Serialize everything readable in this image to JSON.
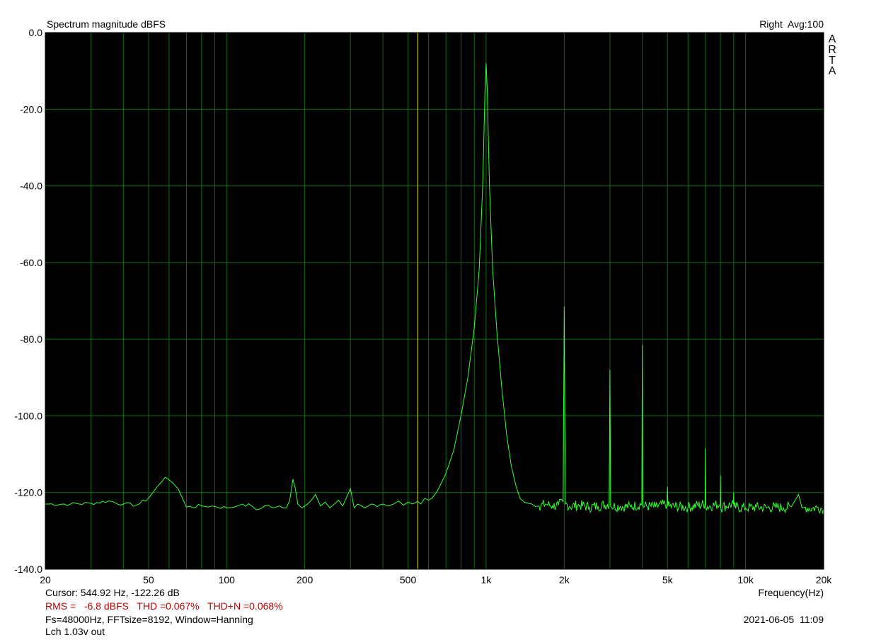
{
  "header": {
    "title": "Spectrum magnitude dBFS",
    "channel_avg": "Right  Avg:100",
    "brand_letters": [
      "A",
      "R",
      "T",
      "A"
    ]
  },
  "footer": {
    "cursor": "Cursor: 544.92 Hz, -122.26 dB",
    "metrics": "RMS =   -6.8 dBFS   THD =0.067%   THD+N =0.068%",
    "settings": "Fs=48000Hz, FFTsize=8192, Window=Hanning",
    "label": "Lch 1.03v out",
    "datetime": "2021-06-05  11:09"
  },
  "colors": {
    "plot_bg": "#000000",
    "grid": "#0d6e0d",
    "trace": "#33ff33",
    "cursor": "#e0e000",
    "metrics_text": "#c00000"
  },
  "chart_data": {
    "type": "line",
    "x_scale": "log",
    "xlim": [
      20,
      20000
    ],
    "ylim": [
      -140,
      0
    ],
    "xlabel": "Frequency(Hz)",
    "ylabel": "",
    "x_ticks": [
      {
        "value": 20,
        "label": "20"
      },
      {
        "value": 50,
        "label": "50"
      },
      {
        "value": 100,
        "label": "100"
      },
      {
        "value": 200,
        "label": "200"
      },
      {
        "value": 500,
        "label": "500"
      },
      {
        "value": 1000,
        "label": "1k"
      },
      {
        "value": 2000,
        "label": "2k"
      },
      {
        "value": 5000,
        "label": "5k"
      },
      {
        "value": 10000,
        "label": "10k"
      },
      {
        "value": 20000,
        "label": "20k"
      }
    ],
    "y_ticks": [
      {
        "value": 0,
        "label": "0.0"
      },
      {
        "value": -20,
        "label": "-20.0"
      },
      {
        "value": -40,
        "label": "-40.0"
      },
      {
        "value": -60,
        "label": "-60.0"
      },
      {
        "value": -80,
        "label": "-80.0"
      },
      {
        "value": -100,
        "label": "-100.0"
      },
      {
        "value": -120,
        "label": "-120.0"
      },
      {
        "value": -140,
        "label": "-140.0"
      }
    ],
    "cursor_x": 544.92,
    "grid": true,
    "series": [
      {
        "points": [
          [
            20,
            -123
          ],
          [
            25,
            -123
          ],
          [
            30,
            -122.8
          ],
          [
            35,
            -122.2
          ],
          [
            40,
            -123
          ],
          [
            45,
            -123.3
          ],
          [
            50,
            -121.5
          ],
          [
            54,
            -118.5
          ],
          [
            58,
            -116
          ],
          [
            62,
            -117.5
          ],
          [
            65,
            -119
          ],
          [
            70,
            -123.8
          ],
          [
            80,
            -123.5
          ],
          [
            90,
            -123.6
          ],
          [
            100,
            -124
          ],
          [
            110,
            -123.5
          ],
          [
            115,
            -123
          ],
          [
            125,
            -123.5
          ],
          [
            130,
            -124.5
          ],
          [
            140,
            -123.5
          ],
          [
            150,
            -124
          ],
          [
            160,
            -123.5
          ],
          [
            170,
            -124
          ],
          [
            175,
            -122
          ],
          [
            180,
            -116.5
          ],
          [
            184,
            -119
          ],
          [
            188,
            -123
          ],
          [
            195,
            -124
          ],
          [
            205,
            -123
          ],
          [
            212,
            -122
          ],
          [
            220,
            -120.5
          ],
          [
            230,
            -123.5
          ],
          [
            240,
            -122.5
          ],
          [
            250,
            -124
          ],
          [
            260,
            -123
          ],
          [
            270,
            -122
          ],
          [
            280,
            -123.5
          ],
          [
            300,
            -119
          ],
          [
            310,
            -124
          ],
          [
            320,
            -123
          ],
          [
            340,
            -124
          ],
          [
            360,
            -123
          ],
          [
            380,
            -123.7
          ],
          [
            400,
            -123
          ],
          [
            420,
            -123.5
          ],
          [
            440,
            -123
          ],
          [
            460,
            -122.2
          ],
          [
            480,
            -123.3
          ],
          [
            500,
            -122.5
          ],
          [
            520,
            -123
          ],
          [
            545,
            -122.3
          ],
          [
            560,
            -123
          ],
          [
            580,
            -121.5
          ],
          [
            600,
            -122
          ],
          [
            650,
            -119.5
          ],
          [
            700,
            -115
          ],
          [
            750,
            -109
          ],
          [
            800,
            -100
          ],
          [
            850,
            -90
          ],
          [
            900,
            -77
          ],
          [
            940,
            -62
          ],
          [
            970,
            -40
          ],
          [
            990,
            -15
          ],
          [
            1000,
            -8
          ],
          [
            1010,
            -15
          ],
          [
            1030,
            -40
          ],
          [
            1060,
            -62
          ],
          [
            1100,
            -78
          ],
          [
            1150,
            -93
          ],
          [
            1200,
            -105
          ],
          [
            1250,
            -113
          ],
          [
            1300,
            -118
          ],
          [
            1350,
            -121.5
          ],
          [
            1400,
            -122.5
          ],
          [
            1500,
            -123
          ],
          [
            1600,
            -123.5
          ],
          [
            1700,
            -123
          ],
          [
            1800,
            -123.5
          ],
          [
            1900,
            -123.3
          ],
          [
            1980,
            -122.5
          ],
          [
            2000,
            -71.5
          ],
          [
            2020,
            -123
          ],
          [
            2100,
            -123.6
          ],
          [
            2300,
            -123.3
          ],
          [
            2500,
            -123.8
          ],
          [
            2700,
            -123.5
          ],
          [
            2980,
            -123
          ],
          [
            3000,
            -88
          ],
          [
            3020,
            -123.5
          ],
          [
            3300,
            -123.6
          ],
          [
            3600,
            -123.7
          ],
          [
            3980,
            -123
          ],
          [
            4000,
            -81.5
          ],
          [
            4020,
            -123.5
          ],
          [
            4500,
            -123.7
          ],
          [
            4980,
            -123
          ],
          [
            5000,
            -118.5
          ],
          [
            5020,
            -123.6
          ],
          [
            6000,
            -123.8
          ],
          [
            6980,
            -123
          ],
          [
            7000,
            -108.5
          ],
          [
            7020,
            -123.7
          ],
          [
            7980,
            -123
          ],
          [
            8000,
            -115.5
          ],
          [
            8020,
            -123.8
          ],
          [
            8980,
            -123
          ],
          [
            9000,
            -120
          ],
          [
            9020,
            -123.8
          ],
          [
            10000,
            -124
          ],
          [
            11000,
            -123.8
          ],
          [
            12000,
            -124
          ],
          [
            13000,
            -123.8
          ],
          [
            14000,
            -124
          ],
          [
            15000,
            -123.7
          ],
          [
            16000,
            -120.5
          ],
          [
            16500,
            -124
          ],
          [
            17000,
            -123.8
          ],
          [
            18000,
            -124.2
          ],
          [
            19000,
            -123.8
          ],
          [
            20000,
            -124.2
          ]
        ]
      }
    ]
  }
}
